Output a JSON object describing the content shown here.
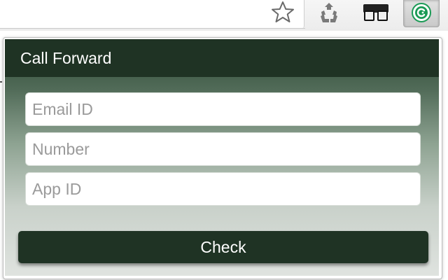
{
  "browser_toolbar": {
    "icons": [
      "star-icon",
      "recycle-icon",
      "glasses-icon",
      "call-forward-extension-icon"
    ]
  },
  "popup": {
    "title": "Call Forward",
    "fields": {
      "email": {
        "placeholder": "Email ID",
        "value": ""
      },
      "number": {
        "placeholder": "Number",
        "value": ""
      },
      "app_id": {
        "placeholder": "App ID",
        "value": ""
      }
    },
    "check_label": "Check"
  },
  "colors": {
    "header": "#1f3324",
    "button": "#1f3324",
    "gradient_top": "#2c4a33",
    "gradient_bottom": "#dfe3df",
    "extension_accent": "#1a9a55"
  }
}
